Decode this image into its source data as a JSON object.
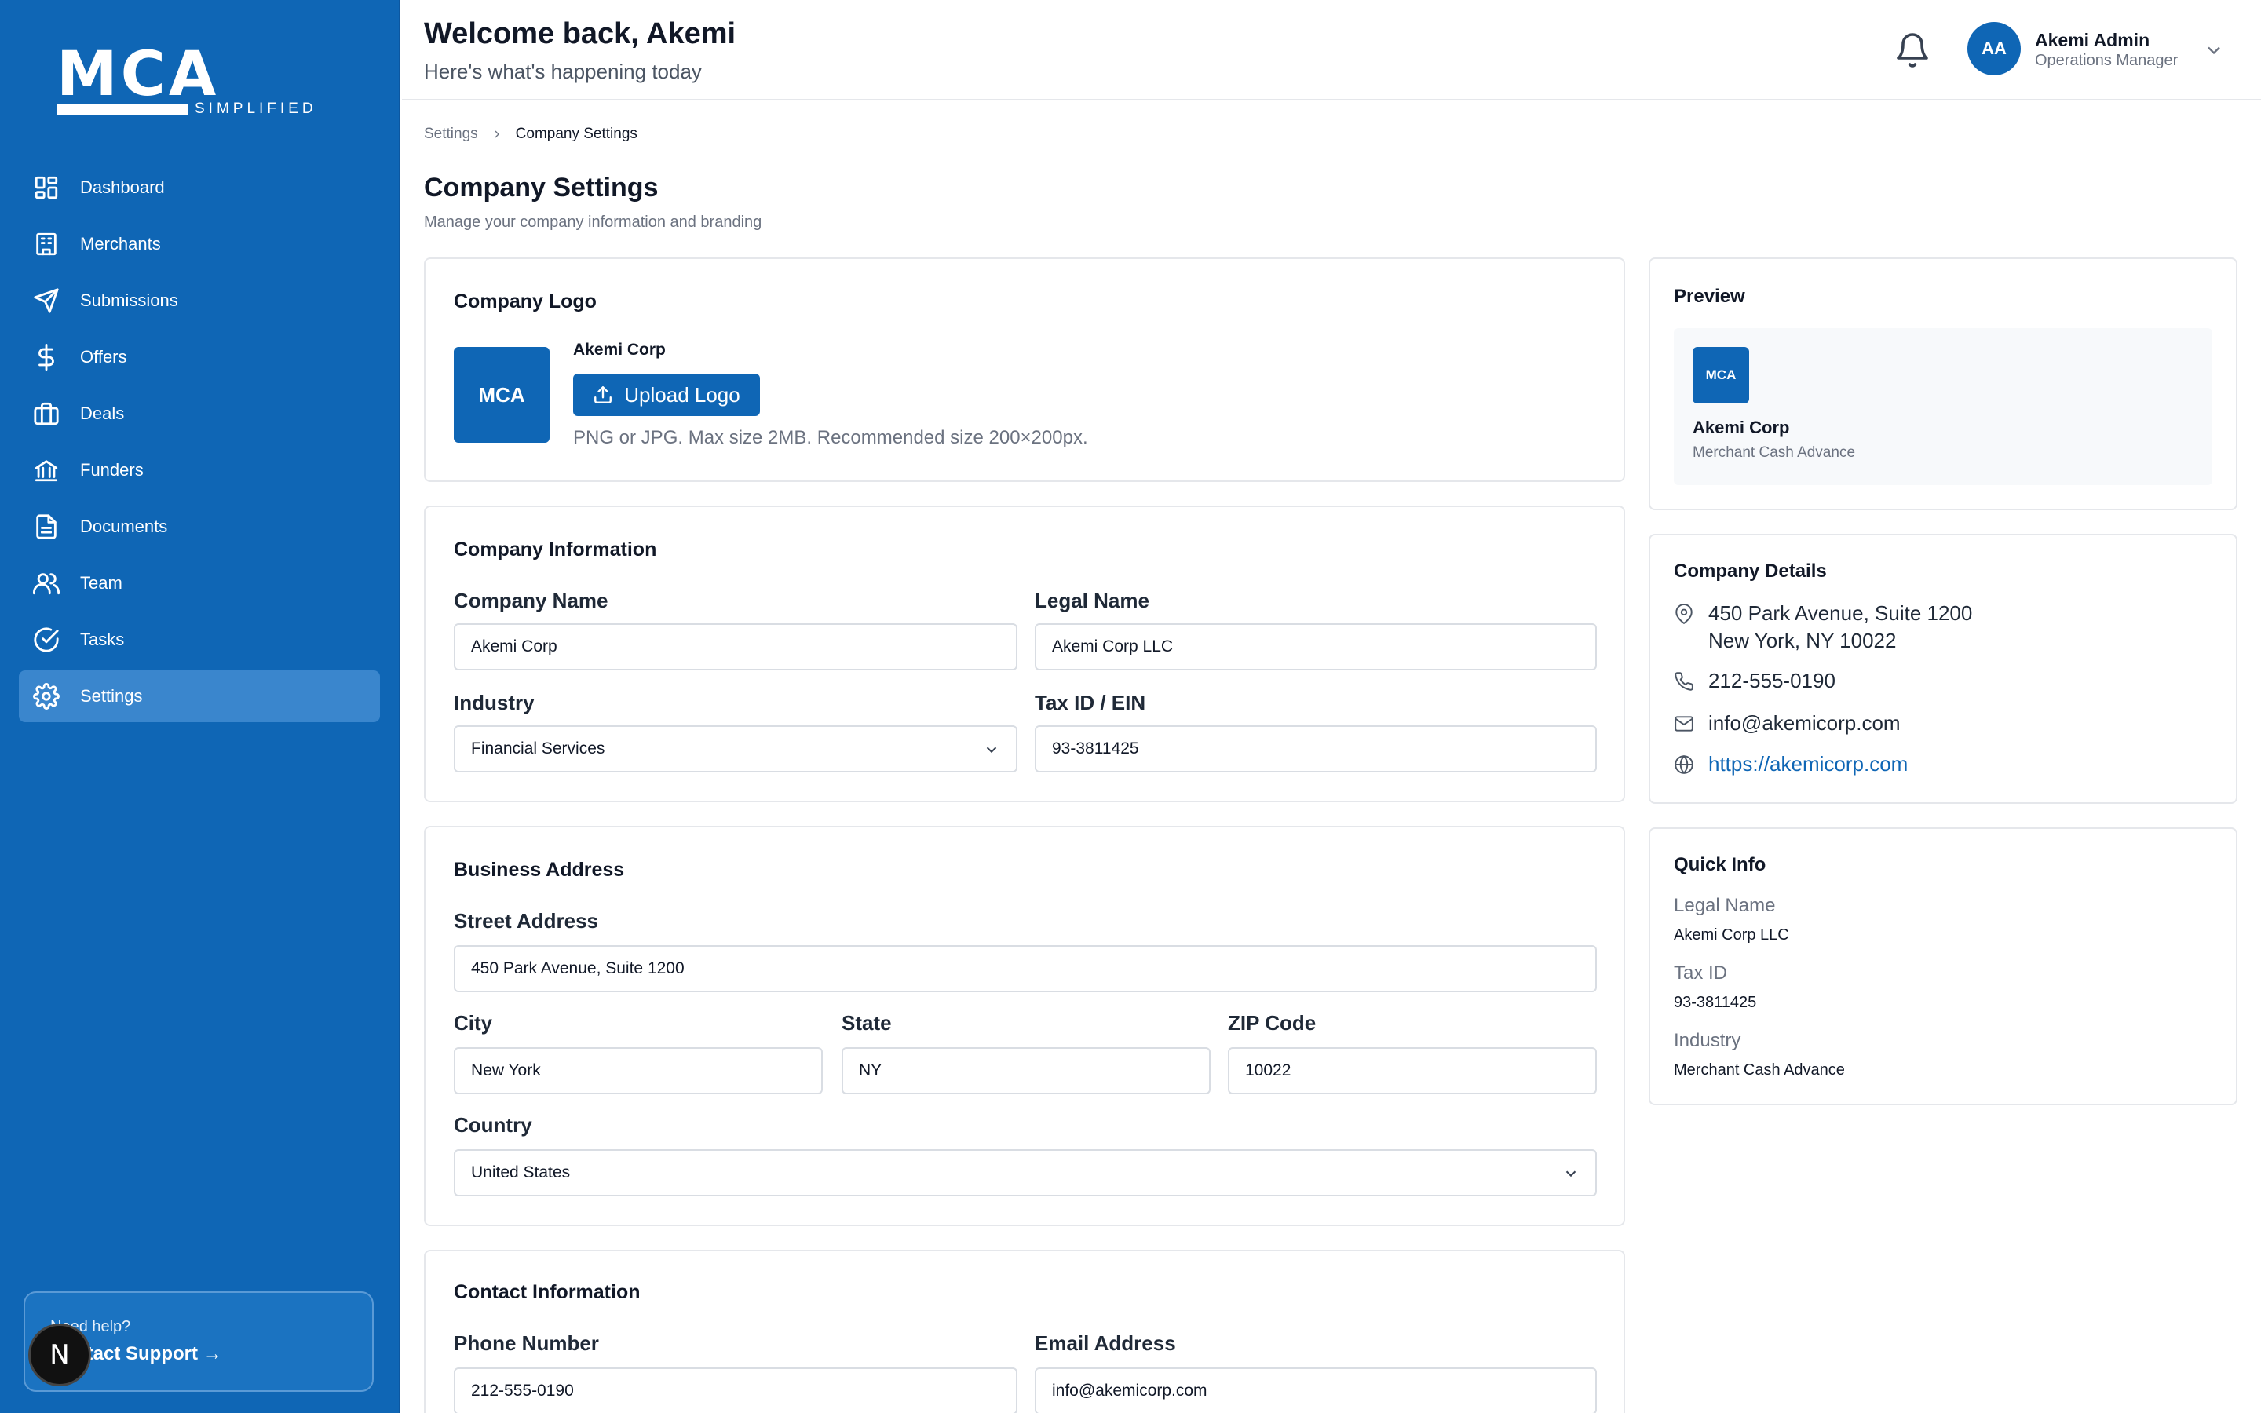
{
  "brand": {
    "logo_text": "MCA",
    "logo_sub": "SIMPLIFIED"
  },
  "sidebar": {
    "items": [
      {
        "label": "Dashboard",
        "icon": "grid-icon"
      },
      {
        "label": "Merchants",
        "icon": "building-icon"
      },
      {
        "label": "Submissions",
        "icon": "send-icon"
      },
      {
        "label": "Offers",
        "icon": "dollar-icon"
      },
      {
        "label": "Deals",
        "icon": "briefcase-icon"
      },
      {
        "label": "Funders",
        "icon": "bank-icon"
      },
      {
        "label": "Documents",
        "icon": "document-icon"
      },
      {
        "label": "Team",
        "icon": "users-icon"
      },
      {
        "label": "Tasks",
        "icon": "check-circle-icon"
      },
      {
        "label": "Settings",
        "icon": "gear-icon",
        "active": true
      }
    ],
    "help": {
      "small": "Need help?",
      "link": "Contact Support →"
    },
    "badge": "N"
  },
  "header": {
    "welcome": "Welcome back, Akemi",
    "subtitle": "Here's what's happening today",
    "user": {
      "initials": "AA",
      "name": "Akemi Admin",
      "role": "Operations Manager"
    }
  },
  "breadcrumb": {
    "parent": "Settings",
    "current": "Company Settings"
  },
  "page": {
    "title": "Company Settings",
    "subtitle": "Manage your company information and branding"
  },
  "logo_card": {
    "title": "Company Logo",
    "logo_text": "MCA",
    "company_name": "Akemi Corp",
    "upload_label": "Upload Logo",
    "hint": "PNG or JPG. Max size 2MB. Recommended size 200×200px."
  },
  "company_info": {
    "title": "Company Information",
    "company_name_label": "Company Name",
    "company_name": "Akemi Corp",
    "legal_name_label": "Legal Name",
    "legal_name": "Akemi Corp LLC",
    "industry_label": "Industry",
    "industry": "Financial Services",
    "tax_label": "Tax ID / EIN",
    "tax": "93-3811425"
  },
  "address": {
    "title": "Business Address",
    "street_label": "Street Address",
    "street": "450 Park Avenue, Suite 1200",
    "city_label": "City",
    "city": "New York",
    "state_label": "State",
    "state": "NY",
    "zip_label": "ZIP Code",
    "zip": "10022",
    "country_label": "Country",
    "country": "United States"
  },
  "contact": {
    "title": "Contact Information",
    "phone_label": "Phone Number",
    "phone": "212-555-0190",
    "email_label": "Email Address",
    "email": "info@akemicorp.com"
  },
  "preview": {
    "title": "Preview",
    "logo_text": "MCA",
    "name": "Akemi Corp",
    "tagline": "Merchant Cash Advance"
  },
  "details": {
    "title": "Company Details",
    "address_line1": "450 Park Avenue, Suite 1200",
    "address_line2": "New York, NY 10022",
    "phone": "212-555-0190",
    "email": "info@akemicorp.com",
    "website": "https://akemicorp.com"
  },
  "quick_info": {
    "title": "Quick Info",
    "legal_label": "Legal Name",
    "legal": "Akemi Corp LLC",
    "tax_label": "Tax ID",
    "tax": "93-3811425",
    "industry_label": "Industry",
    "industry": "Merchant Cash Advance"
  },
  "colors": {
    "primary": "#0f66b5",
    "active_nav": "#3a86cd",
    "border": "#e5e7eb"
  }
}
